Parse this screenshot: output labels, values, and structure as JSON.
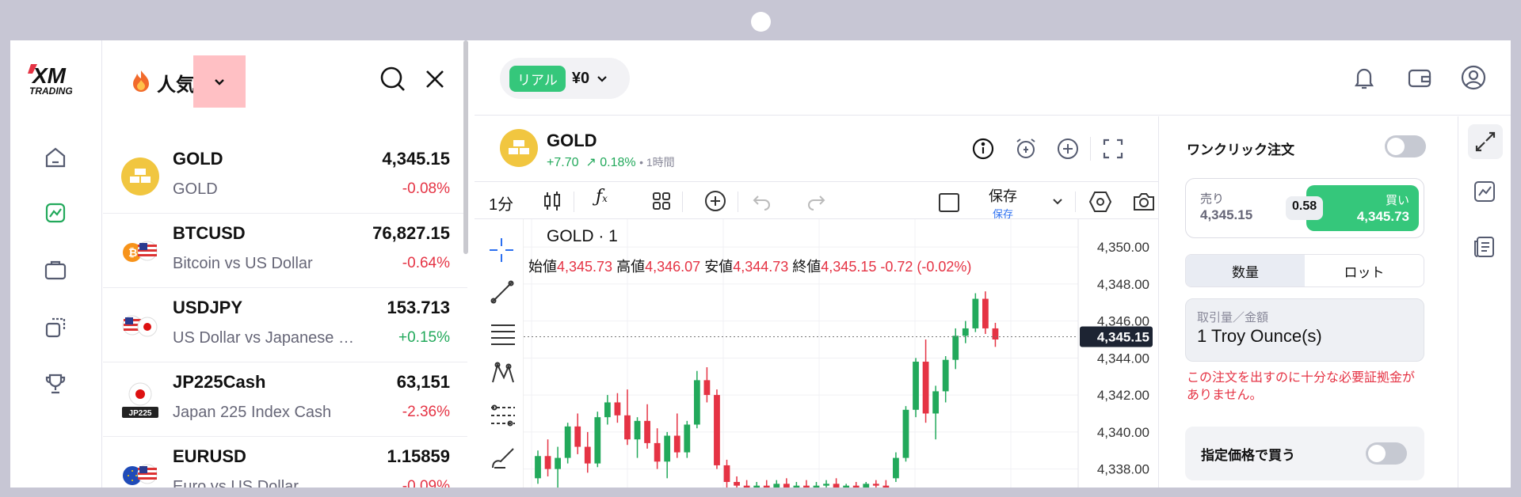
{
  "nav": {
    "logo_text": "XM",
    "logo_sub": "TRADING"
  },
  "panel": {
    "category": "人気",
    "markets": [
      {
        "symbol": "GOLD",
        "desc": "GOLD",
        "price": "4,345.15",
        "change": "-0.08%",
        "dir": "neg",
        "icon": "gold-bars-icon"
      },
      {
        "symbol": "BTCUSD",
        "desc": "Bitcoin vs US Dollar",
        "price": "76,827.15",
        "change": "-0.64%",
        "dir": "neg",
        "icon": "btc-usd-flag-icon"
      },
      {
        "symbol": "USDJPY",
        "desc": "US Dollar vs Japanese …",
        "price": "153.713",
        "change": "+0.15%",
        "dir": "pos",
        "icon": "usd-jpy-flag-icon"
      },
      {
        "symbol": "JP225Cash",
        "desc": "Japan 225 Index Cash",
        "price": "63,151",
        "change": "-2.36%",
        "dir": "neg",
        "icon": "jp225-flag-icon",
        "badge": "JP225"
      },
      {
        "symbol": "EURUSD",
        "desc": "Euro vs US Dollar",
        "price": "1.15859",
        "change": "-0.09%",
        "dir": "neg",
        "icon": "eur-usd-flag-icon"
      }
    ]
  },
  "topbar": {
    "account_type": "リアル",
    "balance": "¥0"
  },
  "instrument": {
    "name": "GOLD",
    "change": "+7.70",
    "change_pct": "0.18%",
    "interval": "• 1時間"
  },
  "toolbar": {
    "timeframe": "1分",
    "save_label": "保存",
    "save_sub": "保存"
  },
  "chart_data": {
    "type": "candlestick",
    "title": "GOLD · 1",
    "ohlc_labels": {
      "open_label": "始値",
      "open": "4,345.73",
      "high_label": "高値",
      "high": "4,346.07",
      "low_label": "安値",
      "low": "4,344.73",
      "close_label": "終値",
      "close": "4,345.15",
      "change": "-0.72 (-0.02%)"
    },
    "y_ticks": [
      "4,350.00",
      "4,348.00",
      "4,346.00",
      "4,344.00",
      "4,342.00",
      "4,340.00",
      "4,338.00"
    ],
    "ylim": [
      4337,
      4351.5
    ],
    "last_price": "4,345.15",
    "candles": [
      [
        4337.5,
        4339.0,
        4337.2,
        4338.7
      ],
      [
        4338.7,
        4339.6,
        4337.6,
        4338.0
      ],
      [
        4338.0,
        4339.2,
        4337.0,
        4338.6
      ],
      [
        4338.6,
        4340.5,
        4338.3,
        4340.3
      ],
      [
        4340.3,
        4341.0,
        4338.8,
        4339.2
      ],
      [
        4339.2,
        4340.0,
        4337.8,
        4338.3
      ],
      [
        4338.3,
        4341.1,
        4338.1,
        4340.8
      ],
      [
        4340.8,
        4342.0,
        4340.4,
        4341.6
      ],
      [
        4341.6,
        4342.1,
        4340.5,
        4340.9
      ],
      [
        4340.9,
        4342.3,
        4339.3,
        4339.6
      ],
      [
        4339.6,
        4340.8,
        4338.6,
        4340.6
      ],
      [
        4340.6,
        4341.5,
        4339.1,
        4339.4
      ],
      [
        4339.4,
        4340.2,
        4338.0,
        4338.4
      ],
      [
        4338.4,
        4340.0,
        4337.5,
        4339.8
      ],
      [
        4339.8,
        4341.0,
        4338.6,
        4338.9
      ],
      [
        4338.9,
        4340.6,
        4338.6,
        4340.4
      ],
      [
        4340.4,
        4343.3,
        4340.2,
        4342.8
      ],
      [
        4342.8,
        4343.5,
        4341.6,
        4342.0
      ],
      [
        4342.0,
        4342.3,
        4338.0,
        4338.2
      ],
      [
        4338.2,
        4338.5,
        4337.0,
        4337.3
      ],
      [
        4337.3,
        4337.6,
        4336.9,
        4337.1
      ],
      [
        4337.1,
        4337.4,
        4336.8,
        4337.0
      ],
      [
        4337.0,
        4337.3,
        4336.8,
        4337.1
      ],
      [
        4337.1,
        4337.4,
        4336.9,
        4337.0
      ],
      [
        4337.0,
        4337.4,
        4336.9,
        4337.2
      ],
      [
        4337.2,
        4337.5,
        4336.9,
        4337.0
      ],
      [
        4337.0,
        4337.3,
        4336.8,
        4337.1
      ],
      [
        4337.1,
        4337.4,
        4336.9,
        4337.0
      ],
      [
        4337.0,
        4337.3,
        4336.9,
        4337.1
      ],
      [
        4337.1,
        4337.4,
        4336.9,
        4337.2
      ],
      [
        4337.2,
        4337.5,
        4336.9,
        4337.0
      ],
      [
        4337.0,
        4337.2,
        4336.8,
        4337.1
      ],
      [
        4337.1,
        4337.3,
        4336.9,
        4337.0
      ],
      [
        4337.0,
        4337.3,
        4336.8,
        4337.2
      ],
      [
        4337.2,
        4337.4,
        4336.9,
        4337.1
      ],
      [
        4337.1,
        4337.4,
        4336.9,
        4337.0
      ],
      [
        4337.5,
        4338.9,
        4337.3,
        4338.6
      ],
      [
        4338.6,
        4341.4,
        4338.4,
        4341.2
      ],
      [
        4341.2,
        4344.0,
        4340.8,
        4343.8
      ],
      [
        4343.8,
        4345.0,
        4340.5,
        4341.0
      ],
      [
        4341.0,
        4342.5,
        4339.6,
        4342.2
      ],
      [
        4342.2,
        4344.1,
        4341.6,
        4343.9
      ],
      [
        4343.9,
        4345.6,
        4343.4,
        4345.2
      ],
      [
        4345.2,
        4346.0,
        4344.8,
        4345.6
      ],
      [
        4345.6,
        4347.5,
        4345.4,
        4347.2
      ],
      [
        4347.2,
        4347.6,
        4345.3,
        4345.6
      ],
      [
        4345.6,
        4345.9,
        4344.6,
        4345.0
      ]
    ]
  },
  "order": {
    "one_click": "ワンクリック注文",
    "sell_label": "売り",
    "sell_price": "4,345.15",
    "spread": "0.58",
    "buy_label": "買い",
    "buy_price": "4,345.73",
    "tab_qty": "数量",
    "tab_lot": "ロット",
    "amount_label": "取引量／金額",
    "amount_value": "1 Troy Ounce(s)",
    "warning": "この注文を出すのに十分な必要証拠金がありません。",
    "limit_label": "指定価格で買う"
  },
  "colors": {
    "accent": "#35c77b",
    "red": "#e53344",
    "green": "#22a95b"
  }
}
